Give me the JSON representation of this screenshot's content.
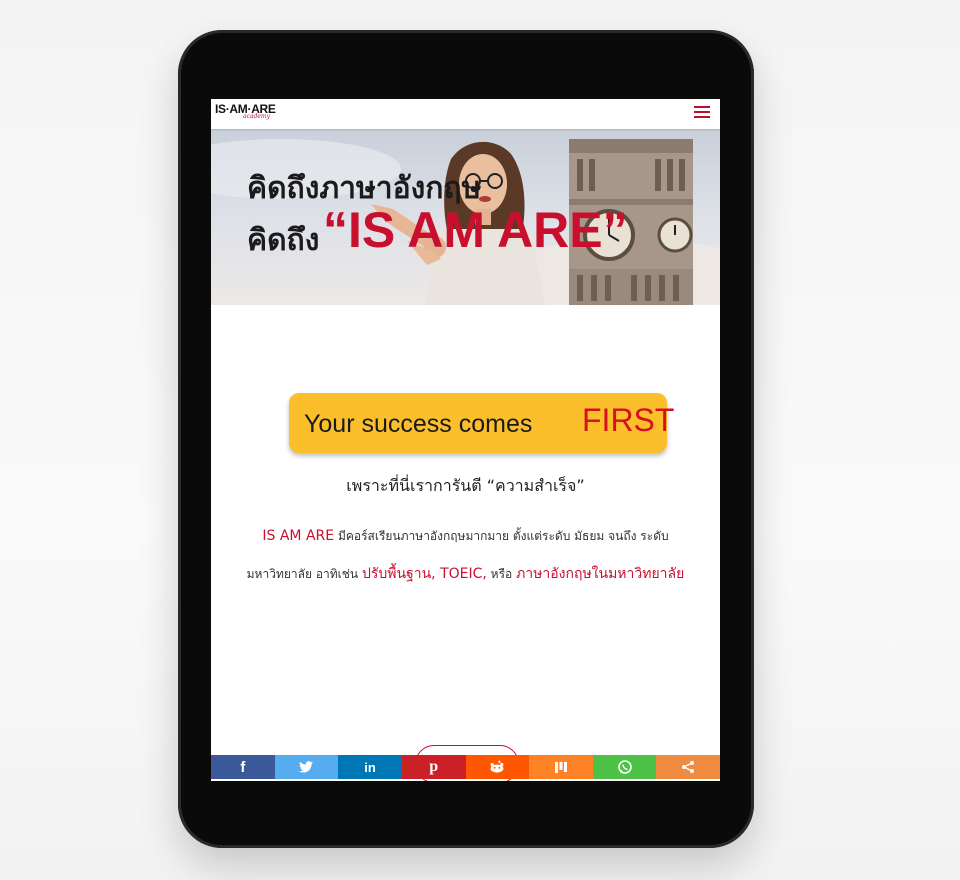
{
  "header": {
    "logo_main": "IS·AM·ARE",
    "logo_sub": "academy"
  },
  "headline": {
    "line1": "คิดถึงภาษาอังกฤษ",
    "line2_prefix": "คิดถึง",
    "brand": "“IS AM ARE”"
  },
  "banner": {
    "text": "Your success comes",
    "emphasis": "FIRST"
  },
  "tagline": "เพราะที่นี่เราการันตี “ความสำเร็จ”",
  "description": {
    "brand": "IS AM ARE",
    "part1": " มีคอร์สเรียนภาษาอังกฤษมากมาย ตั้งแต่ระดับ มัธยม จนถึง ระดับ",
    "part2": "มหาวิทยาลัย อาทิเช่น ",
    "course1": "ปรับพื้นฐาน, TOEIC,",
    "conj": " หรือ ",
    "course2": "ภาษาอังกฤษในมหาวิทยาลัย"
  },
  "share": [
    {
      "name": "facebook",
      "icon": "facebook-icon",
      "color": "#3b5998"
    },
    {
      "name": "twitter",
      "icon": "twitter-icon",
      "color": "#55acee"
    },
    {
      "name": "linkedin",
      "icon": "linkedin-icon",
      "color": "#0077b5"
    },
    {
      "name": "pinterest",
      "icon": "pinterest-icon",
      "color": "#cb2027"
    },
    {
      "name": "reddit",
      "icon": "reddit-icon",
      "color": "#ff5700"
    },
    {
      "name": "mix",
      "icon": "mix-icon",
      "color": "#ff8226"
    },
    {
      "name": "whatsapp",
      "icon": "whatsapp-icon",
      "color": "#4dc247"
    },
    {
      "name": "share",
      "icon": "share-icon",
      "color": "#f08a3e"
    }
  ],
  "colors": {
    "brand_red": "#c8102e",
    "banner_yellow": "#fbbf2b"
  }
}
